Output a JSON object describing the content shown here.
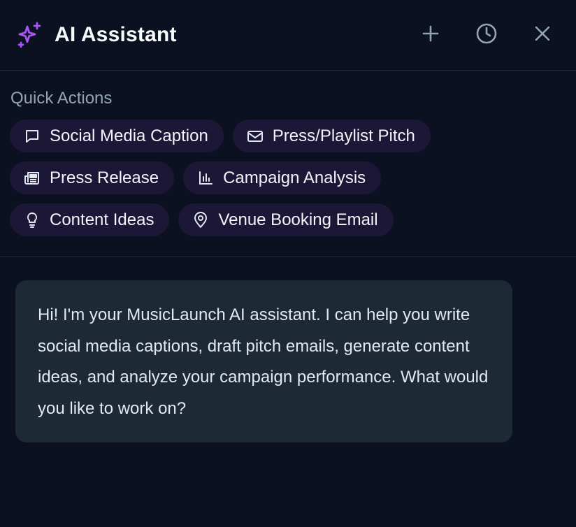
{
  "header": {
    "title": "AI Assistant",
    "icons": {
      "brand": "sparkles-icon",
      "new_chat": "plus-icon",
      "history": "clock-icon",
      "close": "close-icon"
    },
    "accent": "#a855f7"
  },
  "quick_actions": {
    "label": "Quick Actions",
    "rows": [
      [
        {
          "label": "Social Media Caption",
          "icon": "message-square-icon"
        },
        {
          "label": "Press/Playlist Pitch",
          "icon": "mail-icon"
        }
      ],
      [
        {
          "label": "Press Release",
          "icon": "newspaper-icon"
        },
        {
          "label": "Campaign Analysis",
          "icon": "bar-chart-icon"
        }
      ],
      [
        {
          "label": "Content Ideas",
          "icon": "lightbulb-icon"
        },
        {
          "label": "Venue Booking Email",
          "icon": "map-pin-icon"
        }
      ]
    ]
  },
  "messages": [
    {
      "role": "assistant",
      "text": "Hi! I'm your MusicLaunch AI assistant. I can help you write social media captions, draft pitch emails, generate content ideas, and analyze your campaign performance. What would you like to work on?"
    }
  ],
  "colors": {
    "background": "#0b1120",
    "chip_bg": "#1c1737",
    "bubble_bg": "#1e2936",
    "muted_text": "#94a3b8"
  }
}
